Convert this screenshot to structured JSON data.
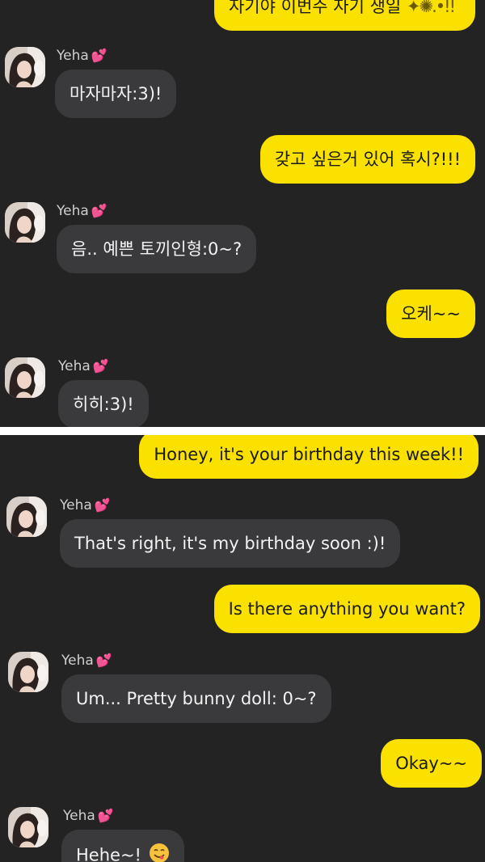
{
  "sender_name": "Yeha",
  "heart_icon": "💕",
  "colors": {
    "background": "#232323",
    "my_bubble": "#fae100",
    "their_bubble": "#3a3a3c"
  },
  "top_panel": {
    "messages": [
      {
        "from": "me",
        "text": "자기야 이번주 자기 생일"
      },
      {
        "from": "Yeha",
        "text": "마자마자:3)!"
      },
      {
        "from": "me",
        "text": "갖고 싶은거 있어 혹시?!!!"
      },
      {
        "from": "Yeha",
        "text": "음.. 예쁜 토끼인형:0~?"
      },
      {
        "from": "me",
        "text": "오케~~"
      },
      {
        "from": "Yeha",
        "text": "히히:3)!"
      }
    ]
  },
  "bottom_panel": {
    "messages": [
      {
        "from": "me",
        "text": "Honey, it's your birthday this week!!"
      },
      {
        "from": "Yeha",
        "text": "That's right, it's my birthday soon :)!"
      },
      {
        "from": "me",
        "text": "Is there anything you want?"
      },
      {
        "from": "Yeha",
        "text": "Um... Pretty bunny doll: 0~?"
      },
      {
        "from": "me",
        "text": "Okay~~"
      },
      {
        "from": "Yeha",
        "text": "Hehe~!",
        "emoji": "yum-face-icon"
      }
    ]
  }
}
